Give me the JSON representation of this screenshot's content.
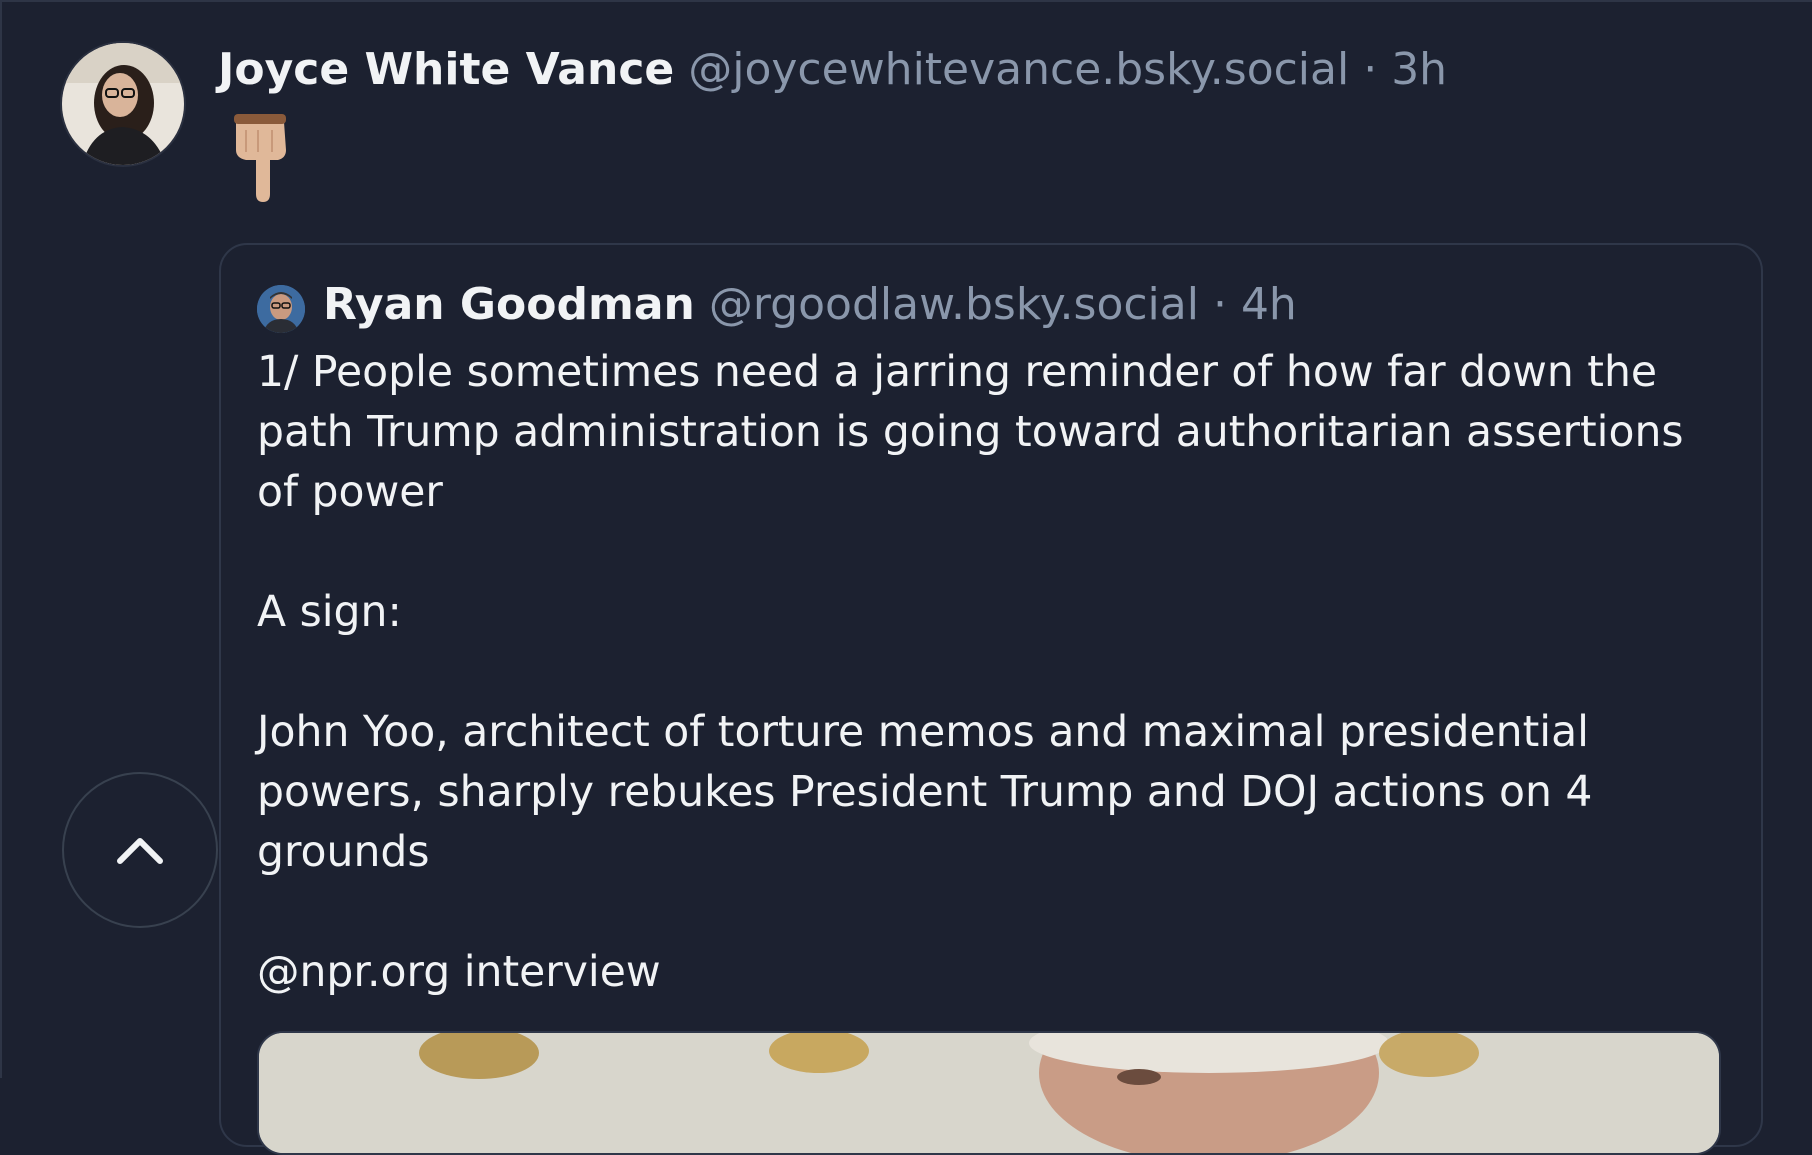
{
  "post": {
    "author_name": "Joyce White Vance",
    "author_handle": "@joycewhitevance.bsky.social",
    "separator": " · ",
    "time": "3h",
    "emoji": "pointing-down-hand-icon"
  },
  "quoted_post": {
    "author_name": "Ryan Goodman",
    "author_handle": "@rgoodlaw.bsky.social",
    "separator": " · ",
    "time": "4h",
    "paragraphs": [
      "1/ People sometimes need a jarring reminder of how far down the path Trump administration is going toward authoritarian assertions of power",
      "A sign:",
      "John Yoo, architect of torture memos and maximal presidential powers, sharply rebukes President Trump and DOJ actions on 4 grounds",
      "@npr.org interview"
    ]
  },
  "colors": {
    "background": "#1c2130",
    "text": "#f1f3f5",
    "muted": "#8a97ab",
    "border": "#2f3749"
  },
  "scroll_top_icon": "chevron-up-icon"
}
